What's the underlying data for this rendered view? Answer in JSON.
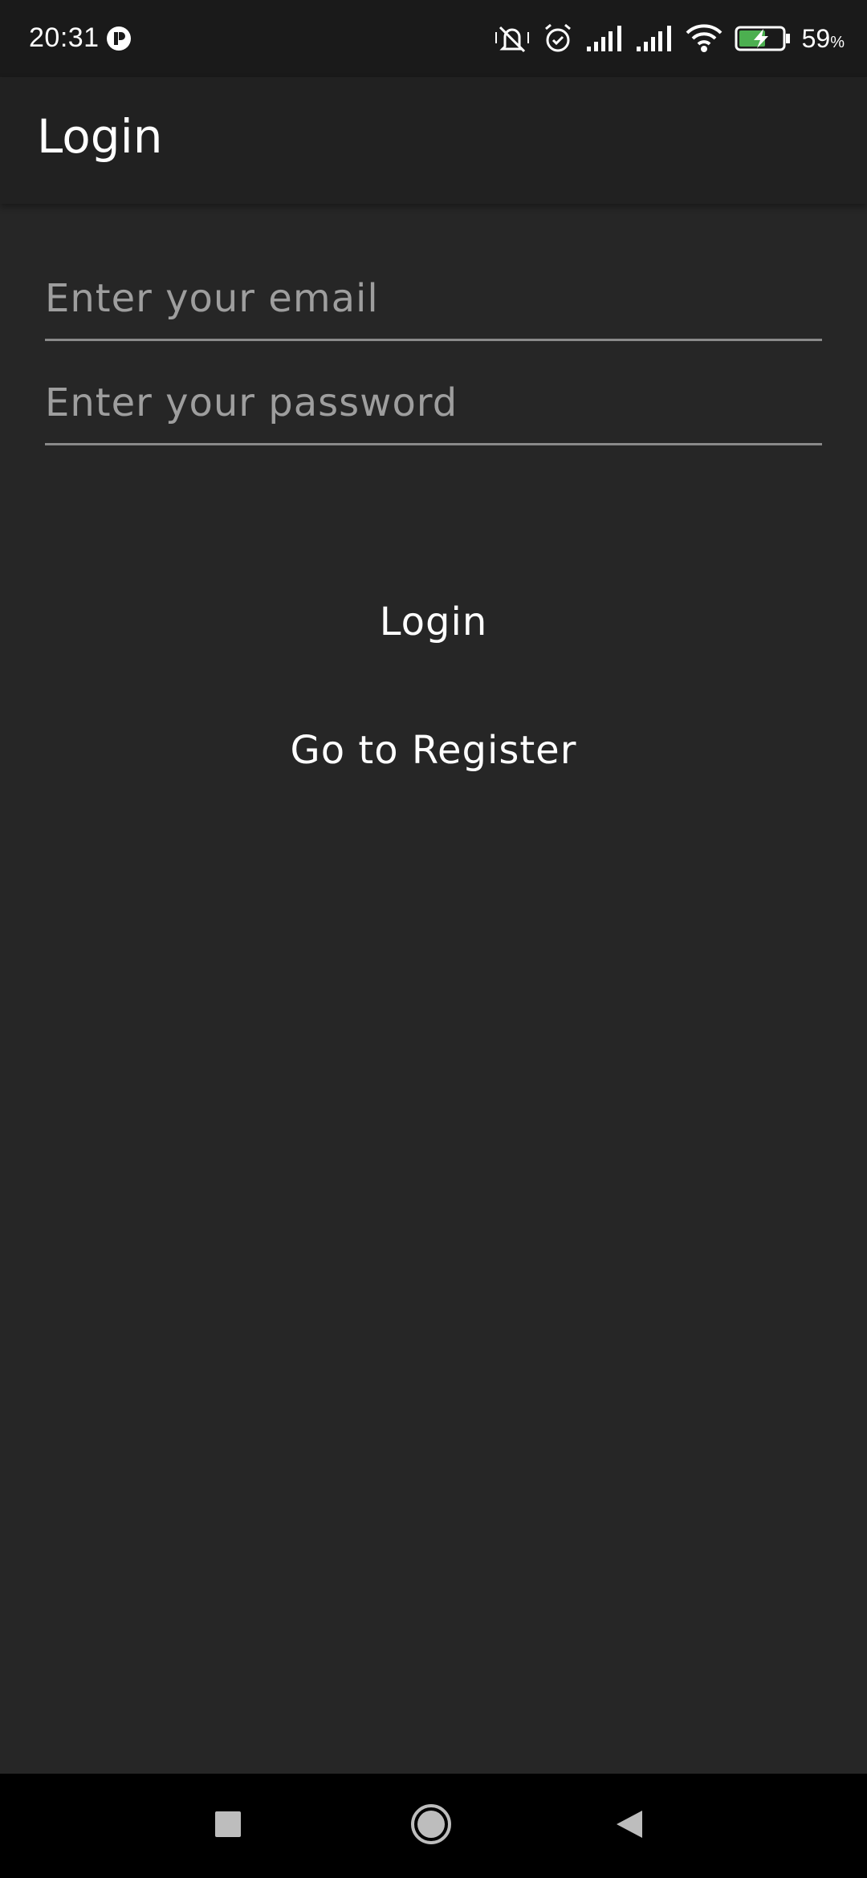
{
  "status_bar": {
    "time": "20:31",
    "battery_percent": "59",
    "battery_unit": "%",
    "icons": [
      "app-notification-icon",
      "mute-icon",
      "alarm-icon",
      "signal-icon",
      "signal-icon",
      "wifi-icon",
      "battery-charging-icon"
    ]
  },
  "app_bar": {
    "title": "Login"
  },
  "form": {
    "email_placeholder": "Enter your email",
    "email_value": "",
    "password_placeholder": "Enter your password",
    "password_value": ""
  },
  "actions": {
    "login_label": "Login",
    "register_label": "Go to Register"
  },
  "nav_bar": {
    "icons": [
      "recents-icon",
      "home-icon",
      "back-icon"
    ]
  },
  "colors": {
    "background": "#262626",
    "app_bar": "#212121",
    "status_bar": "#1a1a1a",
    "nav_bar": "#000000",
    "battery_charge": "#4caf50",
    "underline": "#8a8a8a",
    "placeholder": "#9e9e9e"
  }
}
